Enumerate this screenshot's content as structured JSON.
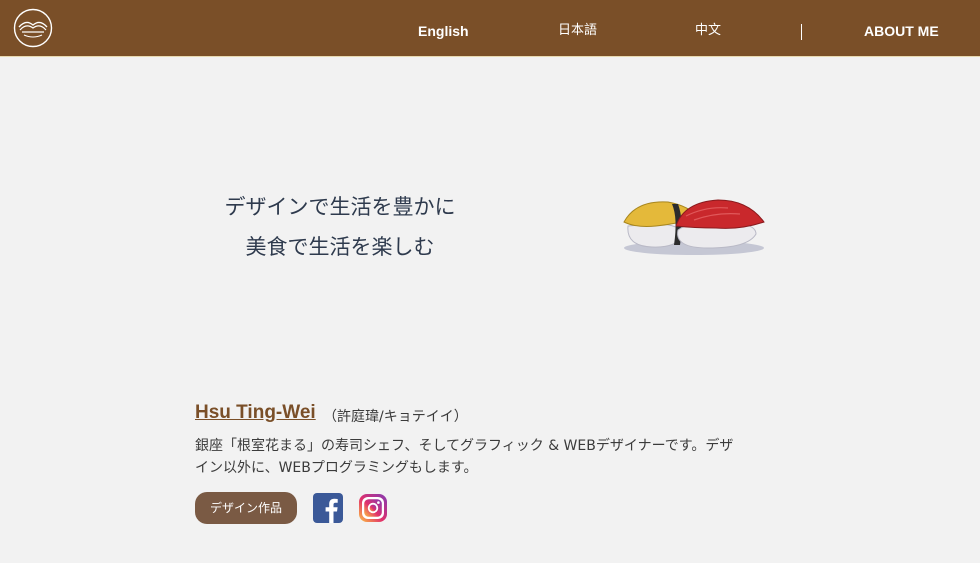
{
  "nav": {
    "logo": "sushi-logo-icon",
    "links": [
      {
        "label": "English"
      },
      {
        "label": "日本語"
      },
      {
        "label": "中文"
      },
      {
        "label": "ABOUT ME"
      }
    ]
  },
  "hero": {
    "line1": "デザインで生活を豊かに",
    "line2": "美食で生活を楽しむ",
    "illustration": "sushi-illustration"
  },
  "profile": {
    "name": "Hsu Ting-Wei",
    "subname": "（許庭瑋/キョテイイ）",
    "description": "銀座「根室花まる」の寿司シェフ、そしてグラフィック & WEBデザイナーです。デザイン以外に、WEBプログラミングもします。",
    "works_button": "デザイン作品",
    "social": [
      {
        "icon": "facebook-icon"
      },
      {
        "icon": "instagram-icon"
      }
    ]
  },
  "colors": {
    "header": "#7a4f28",
    "background": "#f2f2f2",
    "button": "#7a5a44",
    "name_link": "#7a4f28"
  }
}
